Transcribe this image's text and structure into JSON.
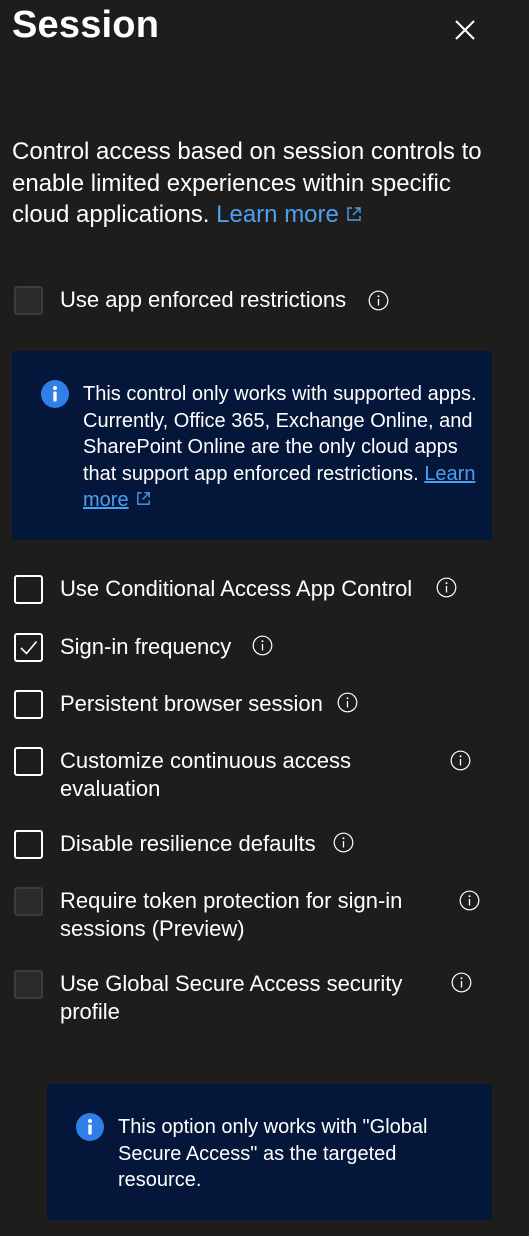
{
  "panel": {
    "title": "Session",
    "description": "Control access based on session controls to enable limited experiences within specific cloud applications.",
    "description_link": "Learn more"
  },
  "info_app_enforced": {
    "text": "This control only works with supported apps. Currently, Office 365, Exchange Online, and SharePoint Online are the only cloud apps that support app enforced restrictions.",
    "link": "Learn more"
  },
  "info_gsa": {
    "text": "This option only works with \"Global Secure Access\" as the targeted resource."
  },
  "options": [
    {
      "label": "Use app enforced restrictions",
      "checked": false,
      "disabled": true
    },
    {
      "label": "Use Conditional Access App Control",
      "checked": false,
      "disabled": false
    },
    {
      "label": "Sign-in frequency",
      "checked": true,
      "disabled": false
    },
    {
      "label": "Persistent browser session",
      "checked": false,
      "disabled": false
    },
    {
      "label": "Customize continuous access evaluation",
      "checked": false,
      "disabled": false
    },
    {
      "label": "Disable resilience defaults",
      "checked": false,
      "disabled": false
    },
    {
      "label": "Require token protection for sign-in sessions (Preview)",
      "checked": false,
      "disabled": true
    },
    {
      "label": "Use Global Secure Access security profile",
      "checked": false,
      "disabled": true
    }
  ],
  "colors": {
    "background": "#1f1d1c",
    "link": "#4aa0f0",
    "info_box": "#04173a",
    "info_badge": "#2f7fe6"
  }
}
